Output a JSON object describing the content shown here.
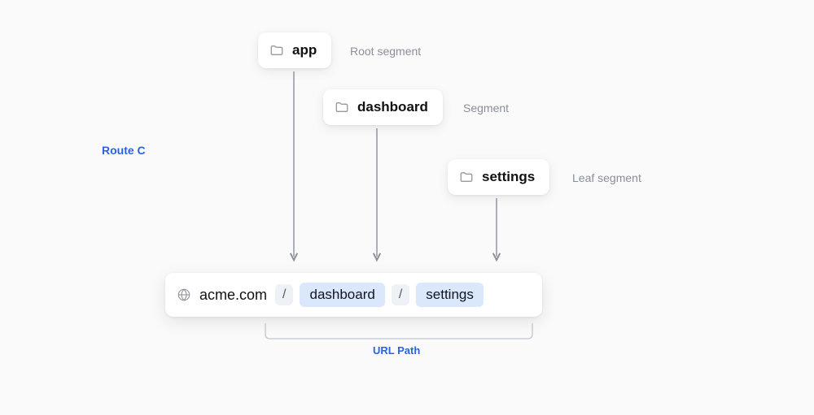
{
  "route_label": "Route C",
  "segments": {
    "app": {
      "name": "app",
      "desc": "Root segment"
    },
    "dashboard": {
      "name": "dashboard",
      "desc": "Segment"
    },
    "settings": {
      "name": "settings",
      "desc": "Leaf segment"
    }
  },
  "url": {
    "domain": "acme.com",
    "slash": "/",
    "dashboard_pill": "dashboard",
    "settings_pill": "settings"
  },
  "urlpath_label": "URL Path"
}
